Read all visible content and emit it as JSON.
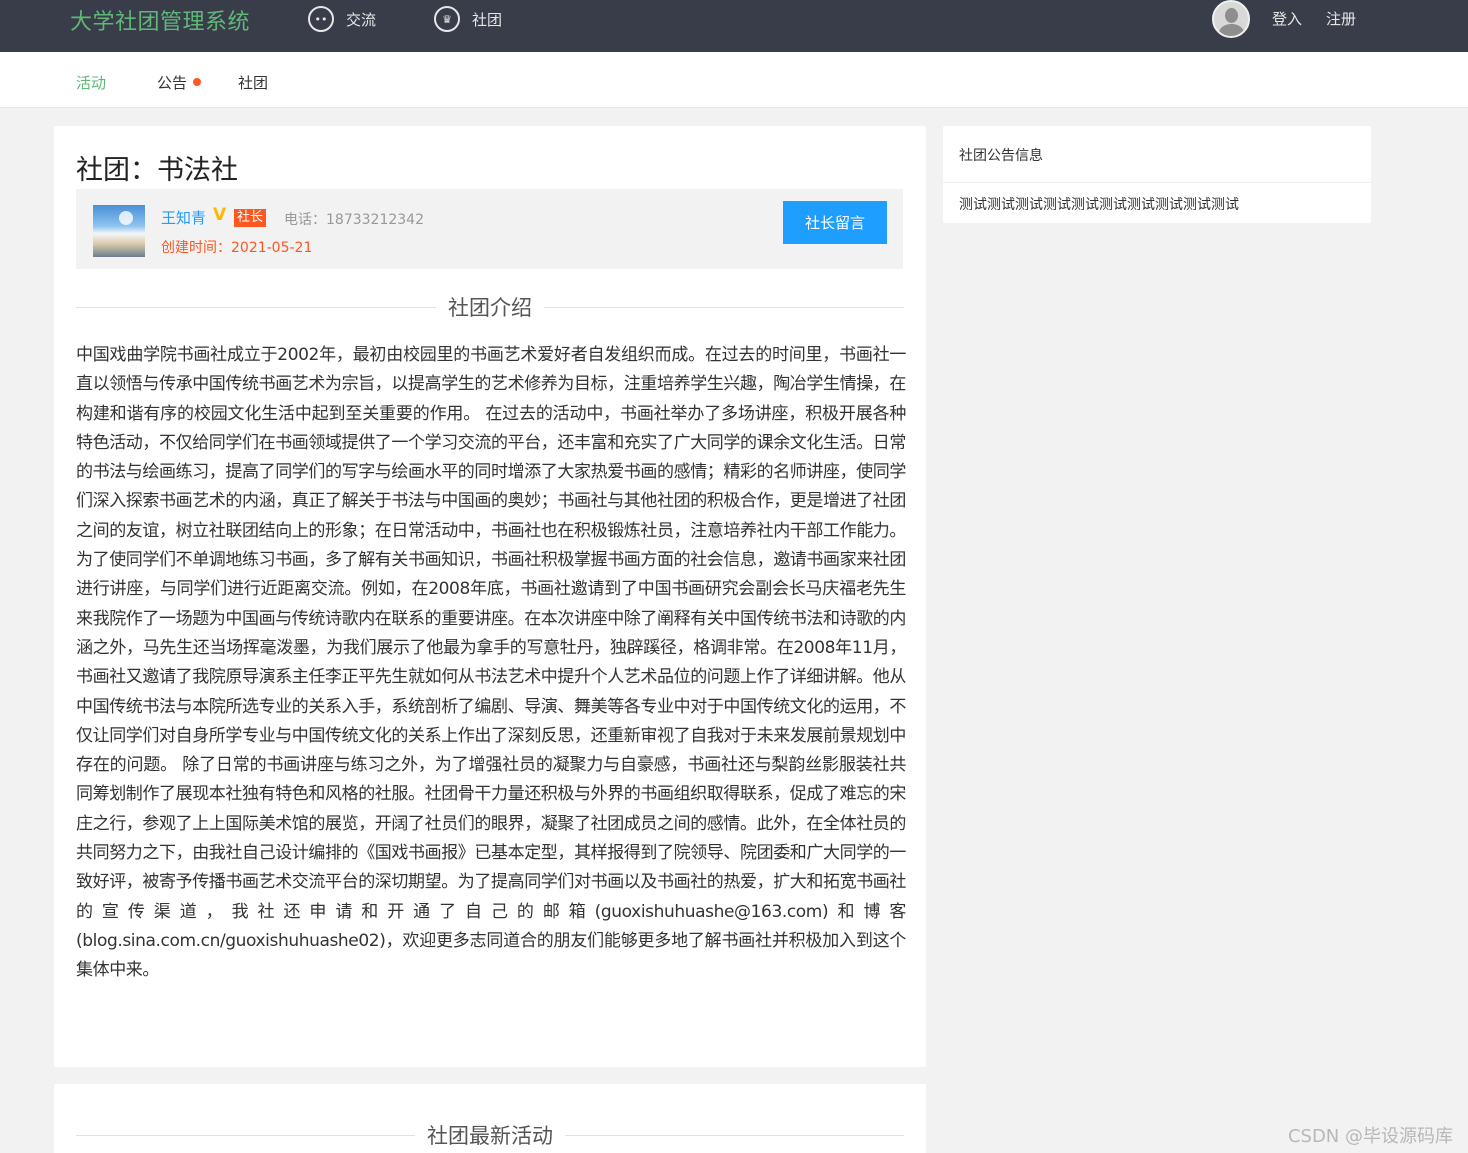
{
  "header": {
    "brand": "大学社团管理系统",
    "nav": [
      {
        "label": "交流",
        "icon": "chat-icon"
      },
      {
        "label": "社团",
        "icon": "crown-icon"
      }
    ],
    "login": "登入",
    "register": "注册"
  },
  "subnav": {
    "items": [
      {
        "label": "活动",
        "active": true
      },
      {
        "label": "公告",
        "has_dot": true
      },
      {
        "label": "社团"
      }
    ]
  },
  "club": {
    "title": "社团：书法社",
    "leader_name": "王知青",
    "verified_mark": "V",
    "role": "社长",
    "phone": "电话：18733212342",
    "created": "创建时间：2021-05-21",
    "message_button": "社长留言",
    "intro_heading": "社团介绍",
    "intro_text": "中国戏曲学院书画社成立于2002年，最初由校园里的书画艺术爱好者自发组织而成。在过去的时间里，书画社一直以领悟与传承中国传统书画艺术为宗旨，以提高学生的艺术修养为目标，注重培养学生兴趣，陶冶学生情操，在构建和谐有序的校园文化生活中起到至关重要的作用。 在过去的活动中，书画社举办了多场讲座，积极开展各种特色活动，不仅给同学们在书画领域提供了一个学习交流的平台，还丰富和充实了广大同学的课余文化生活。日常的书法与绘画练习，提高了同学们的写字与绘画水平的同时增添了大家热爱书画的感情；精彩的名师讲座，使同学们深入探索书画艺术的内涵，真正了解关于书法与中国画的奥妙；书画社与其他社团的积极合作，更是增进了社团之间的友谊，树立社联团结向上的形象；在日常活动中，书画社也在积极锻炼社员，注意培养社内干部工作能力。 为了使同学们不单调地练习书画，多了解有关书画知识，书画社积极掌握书画方面的社会信息，邀请书画家来社团进行讲座，与同学们进行近距离交流。例如，在2008年底，书画社邀请到了中国书画研究会副会长马庆福老先生来我院作了一场题为中国画与传统诗歌内在联系的重要讲座。在本次讲座中除了阐释有关中国传统书法和诗歌的内涵之外，马先生还当场挥毫泼墨，为我们展示了他最为拿手的写意牡丹，独辟蹊径，格调非常。在2008年11月，书画社又邀请了我院原导演系主任李正平先生就如何从书法艺术中提升个人艺术品位的问题上作了详细讲解。他从中国传统书法与本院所选专业的关系入手，系统剖析了编剧、导演、舞美等各专业中对于中国传统文化的运用，不仅让同学们对自身所学专业与中国传统文化的关系上作出了深刻反思，还重新审视了自我对于未来发展前景规划中存在的问题。 除了日常的书画讲座与练习之外，为了增强社员的凝聚力与自豪感，书画社还与梨韵丝影服装社共同筹划制作了展现本社独有特色和风格的社服。社团骨干力量还积极与外界的书画组织取得联系，促成了难忘的宋庄之行，参观了上上国际美术馆的展览，开阔了社员们的眼界，凝聚了社团成员之间的感情。此外，在全体社员的共同努力之下，由我社自己设计编排的《国戏书画报》已基本定型，其样报得到了院领导、院团委和广大同学的一致好评，被寄予传播书画艺术交流平台的深切期望。为了提高同学们对书画以及书画社的热爱，扩大和拓宽书画社的宣传渠道，我社还申请和开通了自己的邮箱(guoxishuhuashe@163.com)和博客(blog.sina.com.cn/guoxishuhuashe02)，欢迎更多志同道合的朋友们能够更多地了解书画社并积极加入到这个集体中来。",
    "activities_heading": "社团最新活动"
  },
  "sidebar": {
    "title": "社团公告信息",
    "announcement": "测试测试测试测试测试测试测试测试测试测试"
  },
  "watermark": "CSDN @毕设源码库"
}
